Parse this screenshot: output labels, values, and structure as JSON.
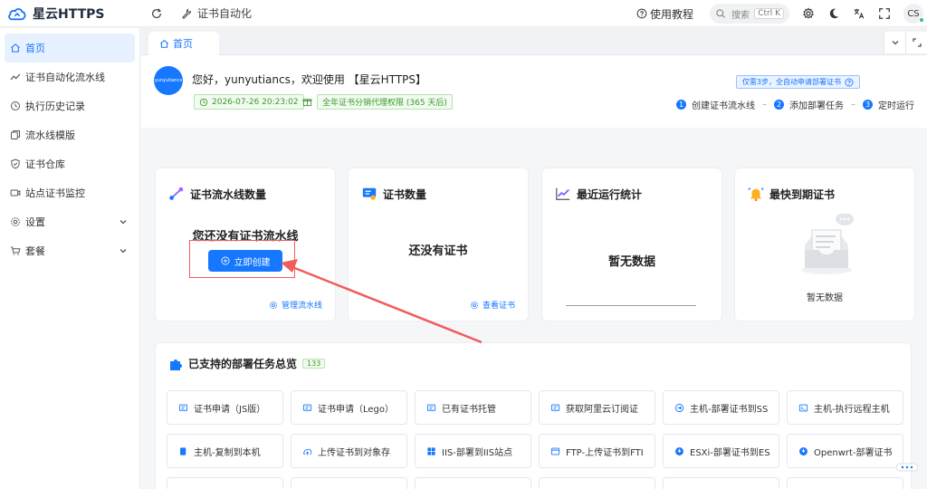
{
  "header": {
    "logo_text": "星云HTTPS",
    "auto_link": "证书自动化",
    "help": "使用教程",
    "search_placeholder": "搜索",
    "search_kbd": "Ctrl K",
    "avatar_initials": "CS"
  },
  "sidebar": {
    "items": [
      {
        "label": "首页",
        "icon": "home-icon",
        "active": true
      },
      {
        "label": "证书自动化流水线",
        "icon": "pipeline-icon"
      },
      {
        "label": "执行历史记录",
        "icon": "history-icon"
      },
      {
        "label": "流水线模版",
        "icon": "template-icon"
      },
      {
        "label": "证书仓库",
        "icon": "shield-icon"
      },
      {
        "label": "站点证书监控",
        "icon": "monitor-icon"
      },
      {
        "label": "设置",
        "icon": "gear-icon",
        "expandable": true
      },
      {
        "label": "套餐",
        "icon": "cart-icon",
        "expandable": true
      }
    ]
  },
  "tabs": [
    {
      "label": "首页"
    }
  ],
  "welcome": {
    "avatar_text": "yunyutiancs",
    "greeting": "您好，yunyutiancs，欢迎使用 【星云HTTPS】",
    "date": "2026-07-26 20:23:02",
    "plan": "全年证书分销代理权限 (365 天后)",
    "hint": "仅需3步，全自动申请部署证书",
    "steps": [
      "创建证书流水线",
      "添加部署任务",
      "定时运行"
    ]
  },
  "cards": {
    "pipelines": {
      "title": "证书流水线数量",
      "empty": "您还没有证书流水线",
      "button": "立即创建",
      "link": "管理流水线"
    },
    "certs": {
      "title": "证书数量",
      "empty": "还没有证书",
      "link": "查看证书"
    },
    "stats": {
      "title": "最近运行统计",
      "empty": "暂无数据"
    },
    "expiring": {
      "title": "最快到期证书",
      "empty": "暂无数据"
    }
  },
  "tasks": {
    "title": "已支持的部署任务总览",
    "count": "133",
    "items": [
      "证书申请（JS版）",
      "证书申请（Lego）",
      "已有证书托管",
      "获取阿里云订阅证",
      "主机-部署证书到SS",
      "主机-执行远程主机",
      "主机-复制到本机",
      "上传证书到对象存",
      "IIS-部署到IIS站点",
      "FTP-上传证书到FTI",
      "ESXi-部署证书到ES",
      "Openwrt-部署证书"
    ]
  },
  "colors": {
    "primary": "#1677ff",
    "success": "#3c9a2b",
    "annotation": "#f25c5c"
  }
}
